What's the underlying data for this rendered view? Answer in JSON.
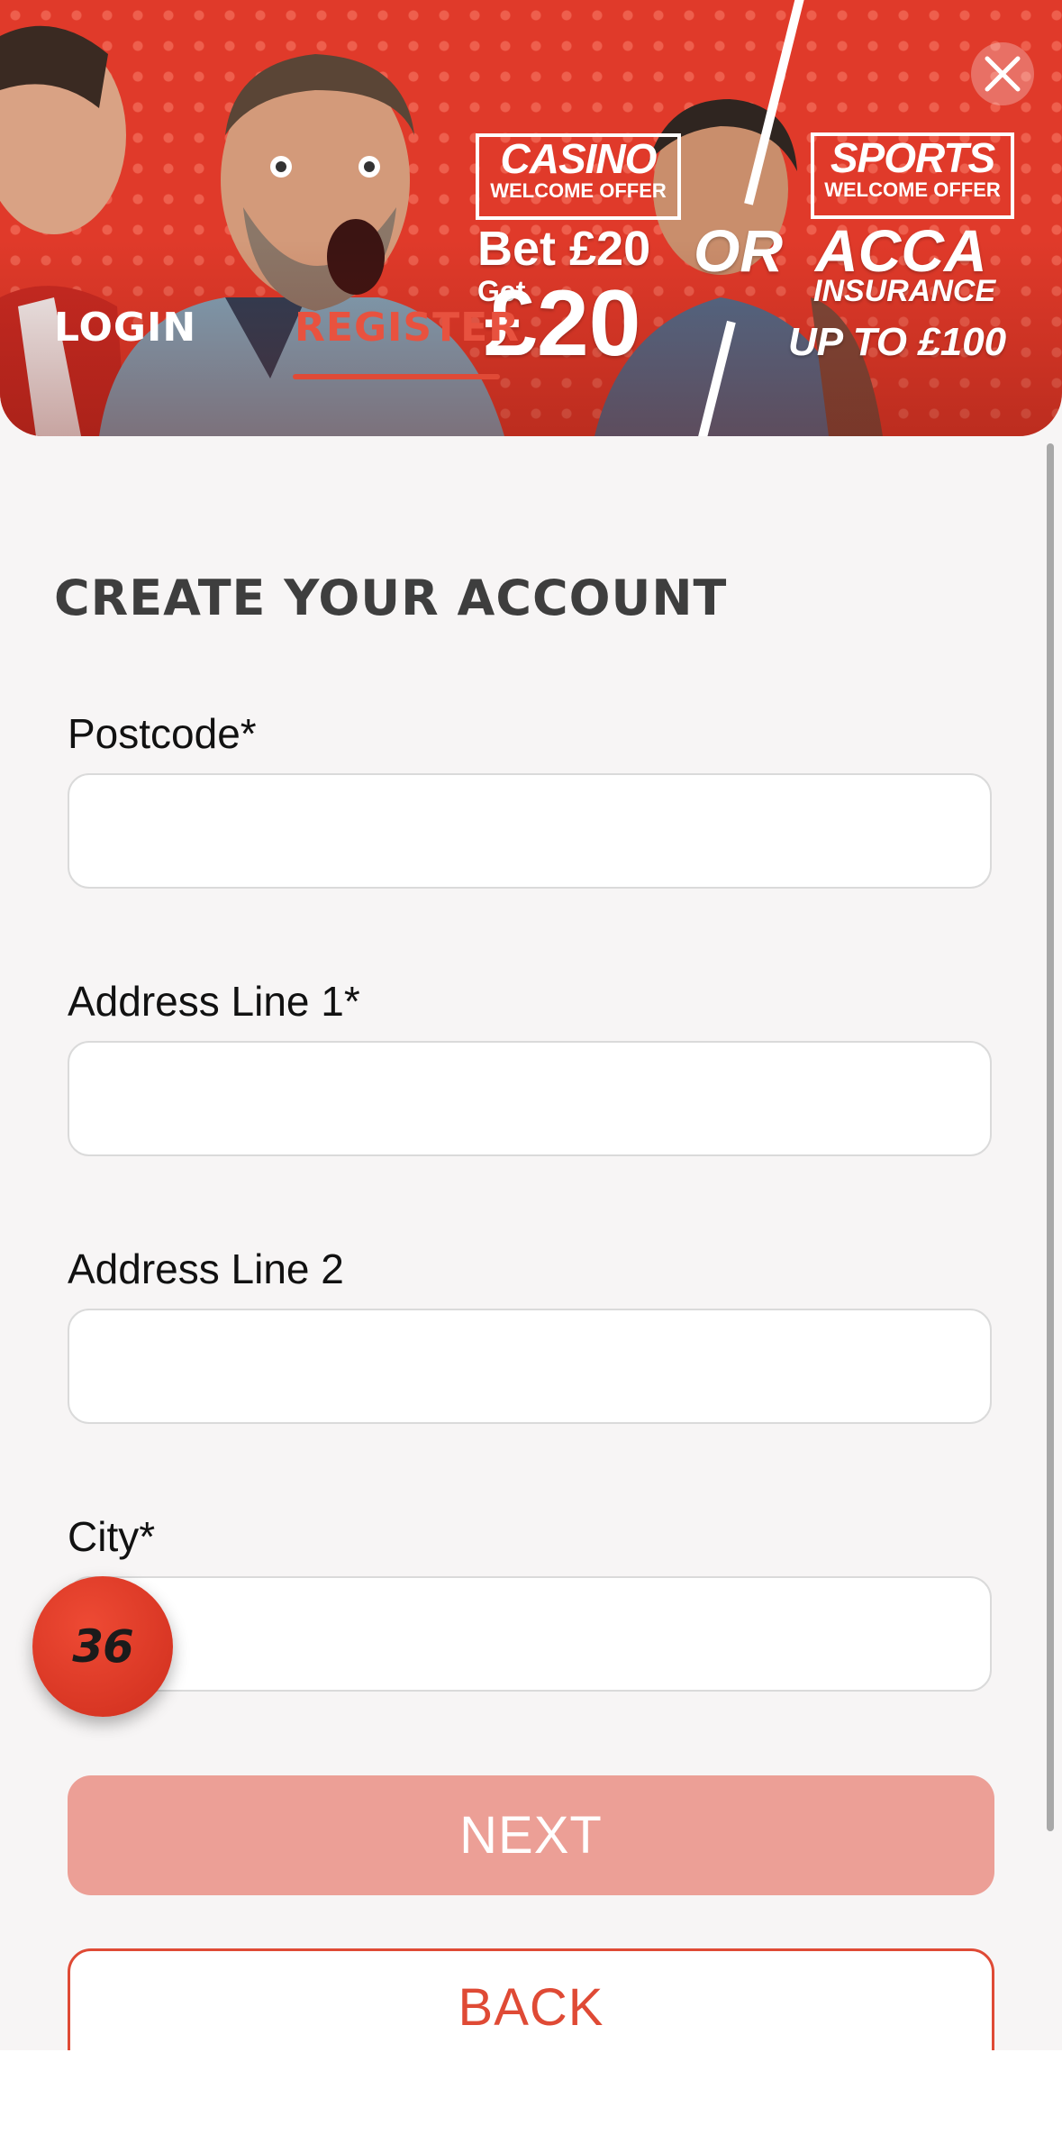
{
  "banner": {
    "tabs": {
      "login": "LOGIN",
      "register": "REGISTER"
    },
    "casino_offer": {
      "title": "CASINO",
      "subtitle": "WELCOME OFFER",
      "line1": "Bet £20",
      "line2": "Get",
      "amount": "£20"
    },
    "or_text": "OR",
    "sports_offer": {
      "title": "SPORTS",
      "subtitle": "WELCOME OFFER",
      "line1": "ACCA",
      "line2": "INSURANCE",
      "line3": "UP TO £100"
    },
    "close_icon": "close-icon",
    "colors": {
      "background": "#e03a2a",
      "active_tab": "#e8523f"
    }
  },
  "form": {
    "title": "CREATE YOUR ACCOUNT",
    "fields": [
      {
        "label": "Postcode",
        "required_mark": "*",
        "value": ""
      },
      {
        "label": "Address Line 1",
        "required_mark": "*",
        "value": ""
      },
      {
        "label": "Address Line 2",
        "required_mark": "",
        "value": ""
      },
      {
        "label": "City",
        "required_mark": "*",
        "value": ""
      }
    ],
    "next_label": "NEXT",
    "back_label": "BACK",
    "colors": {
      "accent": "#df4a35",
      "next_disabled": "#ec9f96"
    }
  },
  "badge": {
    "text": "36"
  }
}
